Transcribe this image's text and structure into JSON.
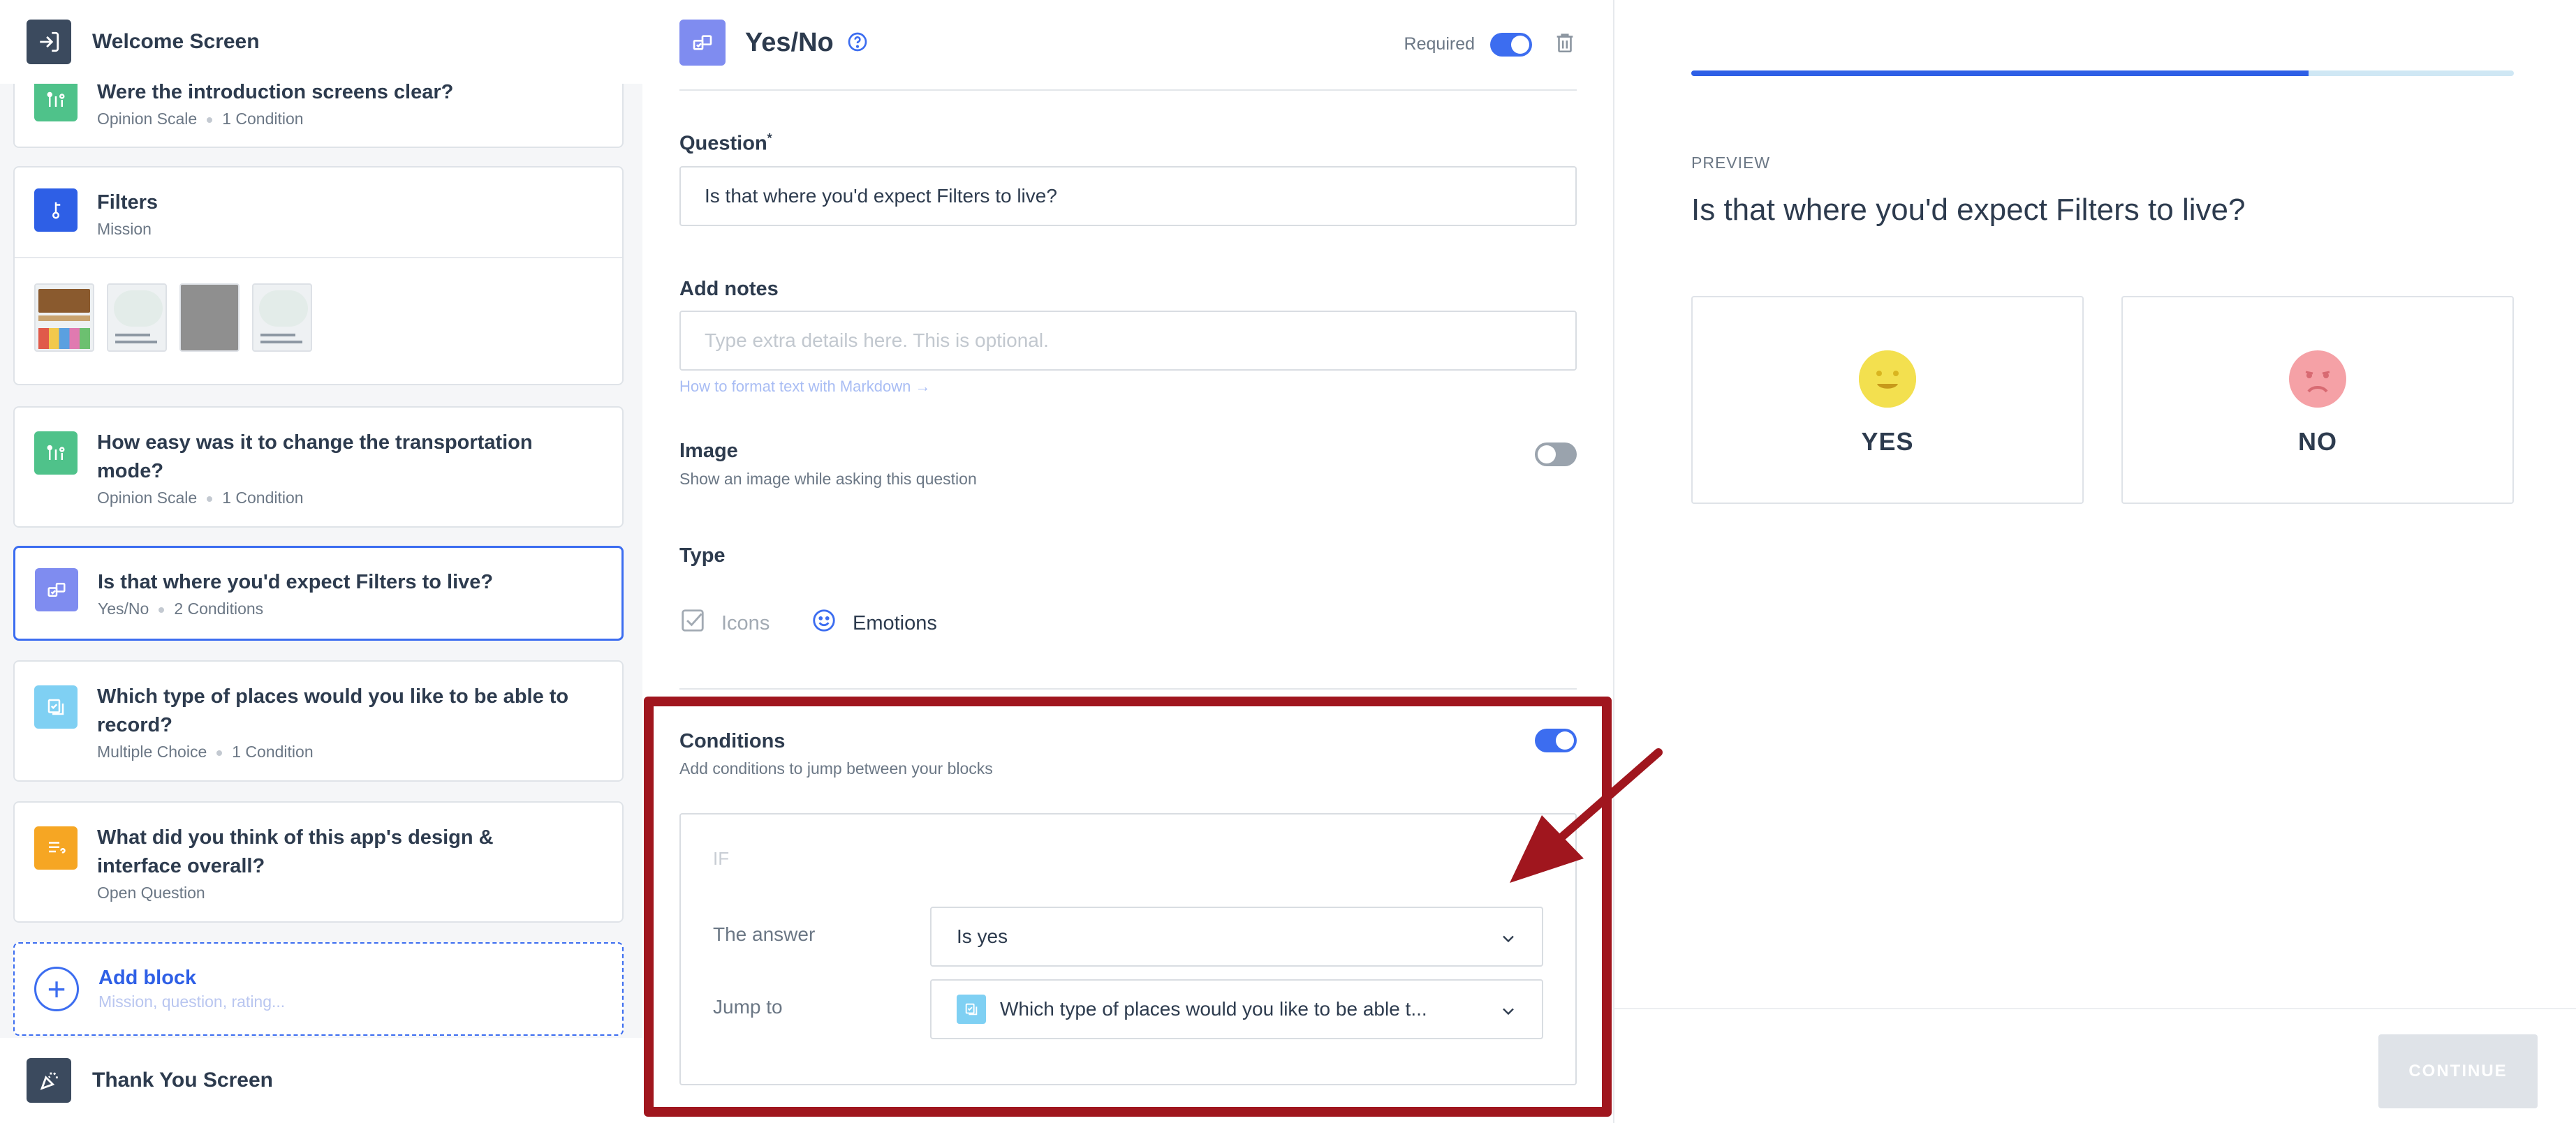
{
  "sidebar": {
    "welcome_label": "Welcome Screen",
    "thank_you_label": "Thank You Screen",
    "blocks": [
      {
        "title": "Were the introduction screens clear?",
        "type": "Opinion Scale",
        "conditions": "1 Condition",
        "color": "#4fc28a"
      },
      {
        "title": "Filters",
        "type": "Mission",
        "color": "#2e5fe6"
      },
      {
        "title": "How easy was it to change the transportation mode?",
        "type": "Opinion Scale",
        "conditions": "1 Condition",
        "color": "#4fc28a"
      },
      {
        "title": "Is that where you'd expect Filters to live?",
        "type": "Yes/No",
        "conditions": "2 Conditions",
        "color": "#7f8cf0"
      },
      {
        "title": "Which type of places would you like to be able to record?",
        "type": "Multiple Choice",
        "conditions": "1 Condition",
        "color": "#7fd0f3"
      },
      {
        "title": "What did you think of this app's design & interface overall?",
        "type": "Open Question",
        "color": "#f6a623"
      }
    ],
    "add_block": {
      "title": "Add block",
      "subtitle": "Mission, question, rating..."
    }
  },
  "editor": {
    "block_type": "Yes/No",
    "required_label": "Required",
    "question_label": "Question",
    "question_required_mark": "*",
    "question_value": "Is that where you'd expect Filters to live?",
    "notes_label": "Add notes",
    "notes_placeholder": "Type extra details here. This is optional.",
    "markdown_link": "How to format text with Markdown →",
    "image_label": "Image",
    "image_desc": "Show an image while asking this question",
    "type_label": "Type",
    "type_options": {
      "icons": "Icons",
      "emotions": "Emotions"
    },
    "conditions": {
      "title": "Conditions",
      "desc": "Add conditions to jump between your blocks",
      "if_label": "IF",
      "answer_label": "The answer",
      "answer_value": "Is yes",
      "jump_label": "Jump to",
      "jump_value": "Which type of places would you like to be able t..."
    }
  },
  "preview": {
    "label": "PREVIEW",
    "progress": 0.75,
    "question": "Is that where you'd expect Filters to live?",
    "yes_label": "YES",
    "no_label": "NO",
    "continue_label": "CONTINUE"
  }
}
